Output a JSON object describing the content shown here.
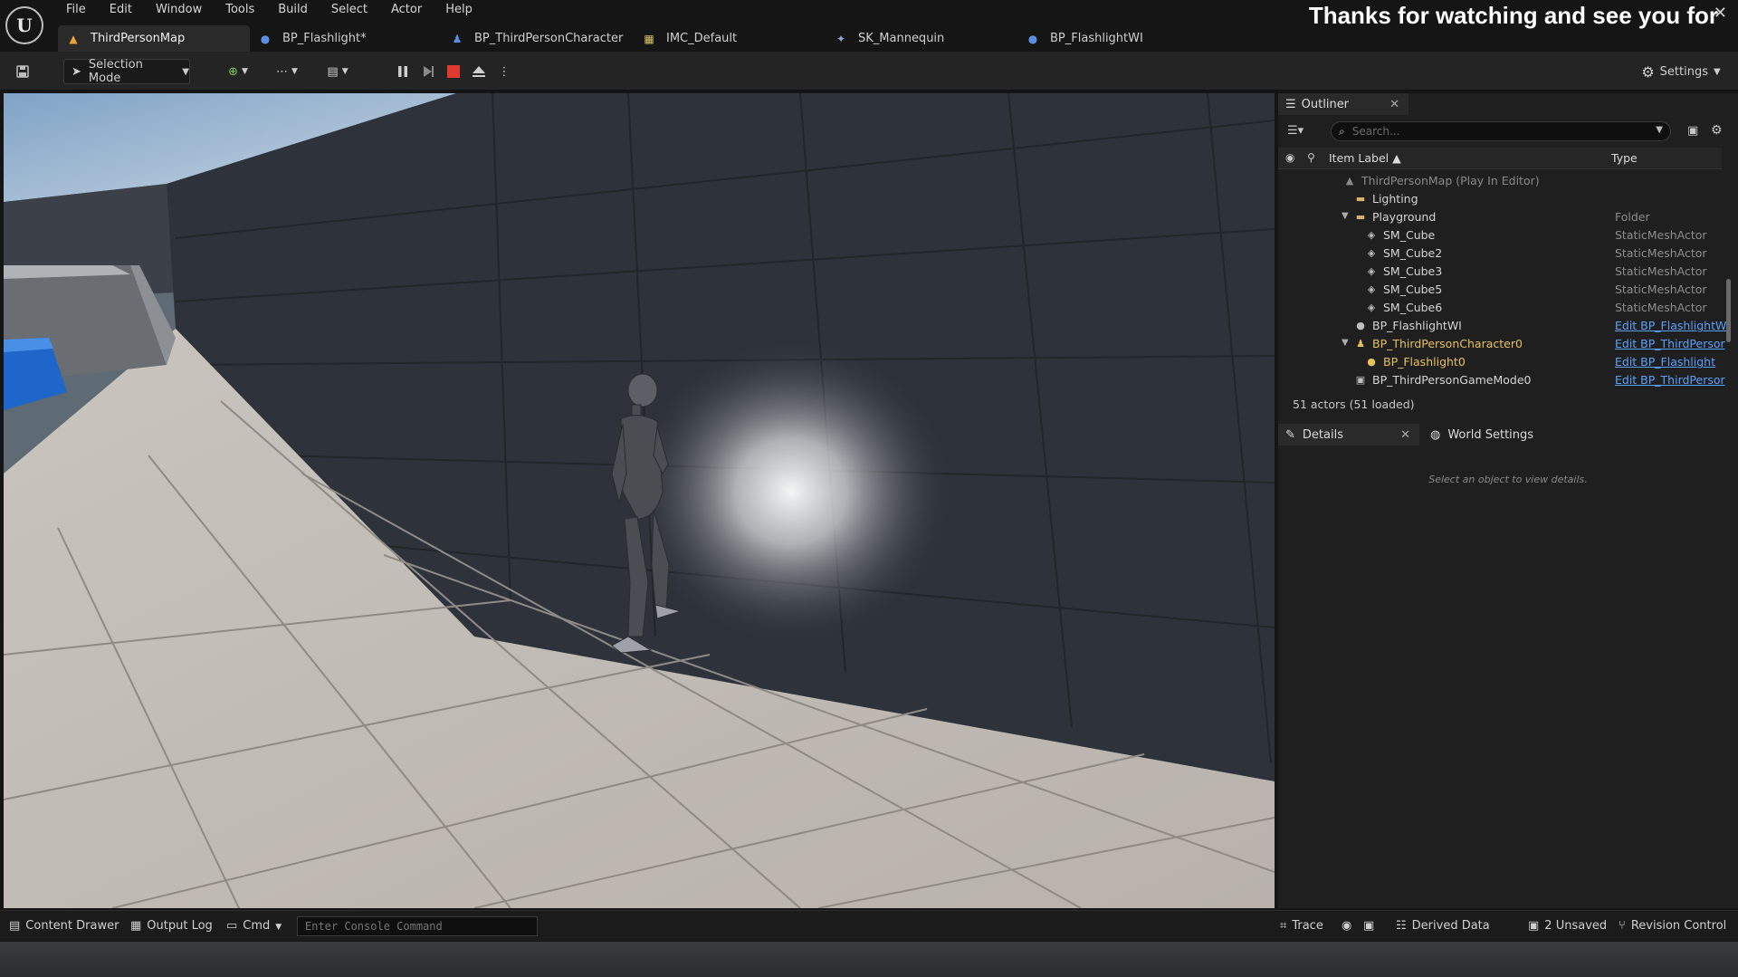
{
  "app": {
    "logo": "U",
    "overlay_banner": "Thanks for watching and see you for",
    "close_glyph": "✕"
  },
  "menu": [
    "File",
    "Edit",
    "Window",
    "Tools",
    "Build",
    "Select",
    "Actor",
    "Help"
  ],
  "tabs": [
    {
      "label": "ThirdPersonMap",
      "icon": "level-icon",
      "active": true
    },
    {
      "label": "BP_Flashlight*",
      "icon": "blueprint-icon"
    },
    {
      "label": "BP_ThirdPersonCharacter",
      "icon": "character-icon"
    },
    {
      "label": "IMC_Default",
      "icon": "input-mapping-icon"
    },
    {
      "label": "SK_Mannequin",
      "icon": "skeleton-icon"
    },
    {
      "label": "BP_FlashlightWI",
      "icon": "blueprint-icon"
    }
  ],
  "toolbar": {
    "selection_mode": "Selection Mode",
    "settings": "Settings"
  },
  "outliner": {
    "tab_label": "Outliner",
    "search_placeholder": "Search...",
    "col_label": "Item Label ▲",
    "col_type": "Type",
    "rows": [
      {
        "label": "ThirdPersonMap (Play In Editor)",
        "type": ""
      },
      {
        "label": "Lighting",
        "type": ""
      },
      {
        "label": "Playground",
        "type": "Folder"
      },
      {
        "label": "SM_Cube",
        "type": "StaticMeshActor"
      },
      {
        "label": "SM_Cube2",
        "type": "StaticMeshActor"
      },
      {
        "label": "SM_Cube3",
        "type": "StaticMeshActor"
      },
      {
        "label": "SM_Cube5",
        "type": "StaticMeshActor"
      },
      {
        "label": "SM_Cube6",
        "type": "StaticMeshActor"
      },
      {
        "label": "BP_FlashlightWI",
        "type": "Edit BP_FlashlightWI"
      },
      {
        "label": "BP_ThirdPersonCharacter0",
        "type": "Edit BP_ThirdPersor"
      },
      {
        "label": "BP_Flashlight0",
        "type": "Edit BP_Flashlight"
      },
      {
        "label": "BP_ThirdPersonGameMode0",
        "type": "Edit BP_ThirdPersor"
      }
    ],
    "actor_count": "51 actors (51 loaded)"
  },
  "details": {
    "tab_label": "Details",
    "world_settings": "World Settings",
    "empty_hint": "Select an object to view details."
  },
  "bottom": {
    "content_drawer": "Content Drawer",
    "output_log": "Output Log",
    "cmd": "Cmd",
    "console_placeholder": "Enter Console Command",
    "trace": "Trace",
    "derived_data": "Derived Data",
    "unsaved": "2 Unsaved",
    "revision_control": "Revision Control"
  },
  "colors": {
    "accent_link": "#5aa1ff",
    "character_highlight": "#e8c15a",
    "stop_red": "#e0392f"
  }
}
